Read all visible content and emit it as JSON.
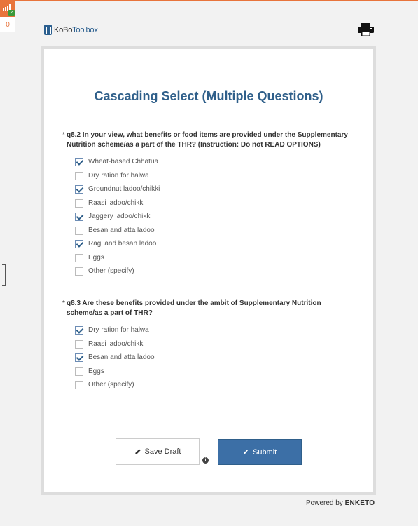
{
  "status_widget": {
    "count": "0",
    "accent": "#e8743b"
  },
  "header": {
    "logo_bold": "KoBo",
    "logo_light": "Toolbox",
    "print_icon": "printer-icon"
  },
  "form": {
    "title": "Cascading Select (Multiple Questions)",
    "questions": [
      {
        "required": "*",
        "label": "q8.2 In your view, what benefits or food items are provided under the Supplementary Nutrition scheme/as a part of the THR? (Instruction: Do not READ OPTIONS)",
        "options": [
          {
            "label": "Wheat-based Chhatua",
            "checked": true
          },
          {
            "label": "Dry ration for halwa",
            "checked": false
          },
          {
            "label": "Groundnut ladoo/chikki",
            "checked": true
          },
          {
            "label": "Raasi ladoo/chikki",
            "checked": false
          },
          {
            "label": "Jaggery ladoo/chikki",
            "checked": true
          },
          {
            "label": "Besan and atta ladoo",
            "checked": false
          },
          {
            "label": "Ragi and besan ladoo",
            "checked": true
          },
          {
            "label": "Eggs",
            "checked": false
          },
          {
            "label": "Other (specify)",
            "checked": false
          }
        ]
      },
      {
        "required": "*",
        "label": "q8.3 Are these benefits provided under the ambit of Supplementary Nutrition scheme/as a part of THR?",
        "options": [
          {
            "label": "Dry ration for halwa",
            "checked": true
          },
          {
            "label": "Raasi ladoo/chikki",
            "checked": false
          },
          {
            "label": "Besan and atta ladoo",
            "checked": true
          },
          {
            "label": "Eggs",
            "checked": false
          },
          {
            "label": "Other (specify)",
            "checked": false
          }
        ]
      }
    ]
  },
  "actions": {
    "save_draft": "Save Draft",
    "submit": "Submit",
    "info_glyph": "i"
  },
  "footer": {
    "powered_by": "Powered by",
    "brand": "ENKETO"
  },
  "colors": {
    "title": "#2f5f8a",
    "submit_bg": "#3c6fa6",
    "card_border": "#dddddd"
  }
}
